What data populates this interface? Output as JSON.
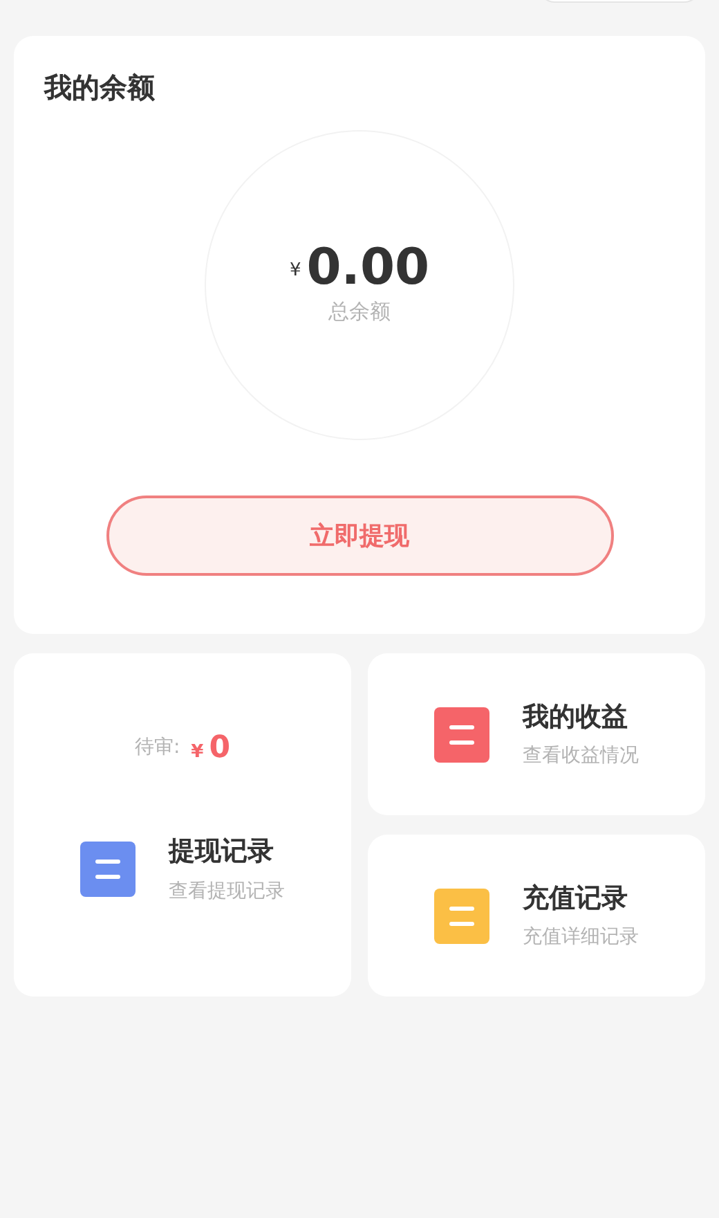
{
  "balance": {
    "title": "我的余额",
    "currency": "¥",
    "amount": "0.00",
    "caption": "总余额",
    "button": "立即提现"
  },
  "pending": {
    "label": "待审:",
    "currency": "¥",
    "amount": "0"
  },
  "entries": [
    {
      "title": "提现记录",
      "subtitle": "查看提现记录",
      "color": "#6b8ef0"
    },
    {
      "title": "我的收益",
      "subtitle": "查看收益情况",
      "color": "#f56469"
    },
    {
      "title": "充值记录",
      "subtitle": "充值详细记录",
      "color": "#fbbf45"
    }
  ]
}
